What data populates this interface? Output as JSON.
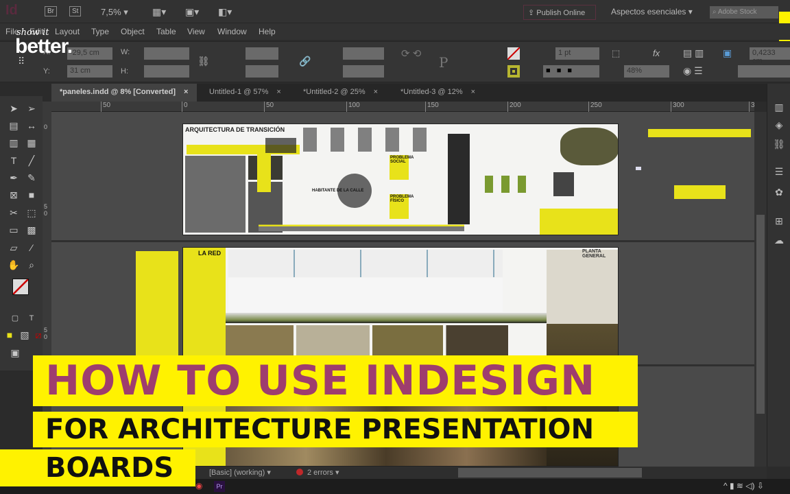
{
  "app": {
    "logo": "Id",
    "bridge": "Br",
    "stock": "St",
    "zoom": "7,5%",
    "publish": "Publish Online",
    "workspace": "Aspectos esenciales",
    "search_placeholder": "Adobe Stock"
  },
  "menu": [
    "File",
    "Edit",
    "Layout",
    "Type",
    "Object",
    "Table",
    "View",
    "Window",
    "Help"
  ],
  "control": {
    "x_label": "X:",
    "x_value": "-29,5 cm",
    "y_label": "Y:",
    "y_value": "31 cm",
    "w_label": "W:",
    "h_label": "H:",
    "stroke_weight": "1 pt",
    "opacity": "48%",
    "offset": "0,4233 cm"
  },
  "tabs": [
    {
      "label": "*paneles.indd @ 8% [Converted]",
      "active": true
    },
    {
      "label": "Untitled-1 @ 57%"
    },
    {
      "label": "*Untitled-2 @ 25%"
    },
    {
      "label": "*Untitled-3 @ 12%"
    }
  ],
  "ruler": {
    "h_ticks": [
      "50",
      "0",
      "50",
      "100",
      "150",
      "200",
      "250",
      "300",
      "3"
    ],
    "v_ticks": [
      "0",
      "5 0",
      "5 0"
    ]
  },
  "boards": {
    "board1_title": "ARQUITECTURA DE TRANSICIÓN",
    "board1_center": "HABITANTE DE LA CALLE",
    "board1_social": "PROBLEMA SOCIAL",
    "board1_fisico": "PROBLEMA FÍSICO",
    "board2_title": "LA RED",
    "board2_plan": "PLANTA GENERAL"
  },
  "status": {
    "preflight_profile": "[Basic] (working)",
    "errors": "2 errors"
  },
  "overlay": {
    "brand_top": "show it",
    "brand_main": "better.",
    "line1": "HOW TO USE INDESIGN",
    "line2": "FOR ARCHITECTURE PRESENTATION",
    "line3": "BOARDS"
  },
  "colors": {
    "accent_yellow": "#fff200",
    "title_purple": "#9e3d6e",
    "ui_bg": "#323232",
    "canvas": "#4a4a4a"
  }
}
